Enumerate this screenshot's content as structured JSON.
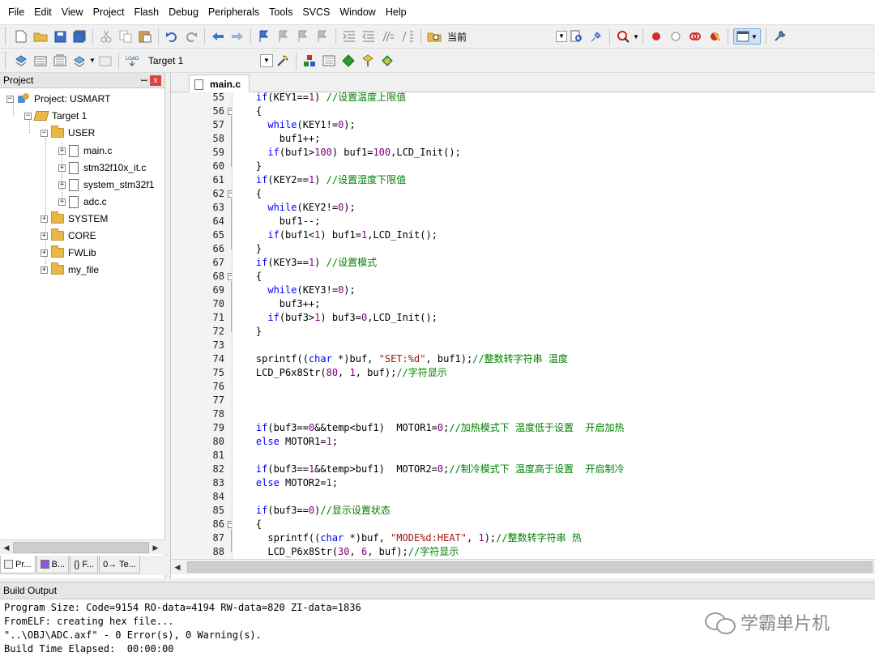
{
  "menu": [
    "File",
    "Edit",
    "View",
    "Project",
    "Flash",
    "Debug",
    "Peripherals",
    "Tools",
    "SVCS",
    "Window",
    "Help"
  ],
  "toolbar": {
    "find_text": "当前",
    "target_select": "Target 1"
  },
  "project_panel": {
    "title": "Project",
    "pin_glyph": "ꟷ",
    "close_glyph": "x",
    "tree": {
      "project": "Project: USMART",
      "target": "Target 1",
      "user": "USER",
      "files": [
        "main.c",
        "stm32f10x_it.c",
        "system_stm32f1",
        "adc.c"
      ],
      "folders": [
        "SYSTEM",
        "CORE",
        "FWLib",
        "my_file"
      ]
    },
    "tabs": [
      "Pr...",
      "B...",
      "{} F...",
      "0→ Te..."
    ]
  },
  "editor": {
    "tab": "main.c",
    "line_numbers": [
      "55",
      "56",
      "57",
      "58",
      "59",
      "60",
      "61",
      "62",
      "63",
      "64",
      "65",
      "66",
      "67",
      "68",
      "69",
      "70",
      "71",
      "72",
      "73",
      "74",
      "75",
      "76",
      "77",
      "78",
      "79",
      "80",
      "81",
      "82",
      "83",
      "84",
      "85",
      "86",
      "87",
      "88"
    ],
    "lines": [
      "    if(KEY1==1) //设置温度上限值",
      "    {",
      "      while(KEY1!=0);",
      "        buf1++;",
      "      if(buf1>100) buf1=100,LCD_Init();",
      "    }",
      "    if(KEY2==1) //设置湿度下限值",
      "    {",
      "      while(KEY2!=0);",
      "        buf1--;",
      "      if(buf1<1) buf1=1,LCD_Init();",
      "    }",
      "    if(KEY3==1) //设置模式",
      "    {",
      "      while(KEY3!=0);",
      "        buf3++;",
      "      if(buf3>1) buf3=0,LCD_Init();",
      "    }",
      "",
      "    sprintf((char *)buf, \"SET:%d\", buf1);//整数转字符串 温度",
      "    LCD_P6x8Str(80, 1, buf);//字符显示",
      "",
      "",
      "",
      "    if(buf3==0&&temp<buf1)  MOTOR1=0;//加热模式下 温度低于设置  开启加热",
      "    else MOTOR1=1;",
      "",
      "    if(buf3==1&&temp>buf1)  MOTOR2=0;//制冷模式下 温度高于设置  开启制冷",
      "    else MOTOR2=1;",
      "",
      "    if(buf3==0)//显示设置状态",
      "    {",
      "      sprintf((char *)buf, \"MODE%d:HEAT\", 1);//整数转字符串 热",
      "      LCD_P6x8Str(30, 6, buf);//字符显示"
    ]
  },
  "build_output": {
    "title": "Build Output",
    "lines": [
      "Program Size: Code=9154 RO-data=4194 RW-data=820 ZI-data=1836",
      "FromELF: creating hex file...",
      "\"..\\OBJ\\ADC.axf\" - 0 Error(s), 0 Warning(s).",
      "Build Time Elapsed:  00:00:00"
    ]
  },
  "watermark": "学霸单片机",
  "colors": {
    "keyword": "#0000ff",
    "number": "#800080",
    "string": "#a31515",
    "comment": "#008000"
  }
}
